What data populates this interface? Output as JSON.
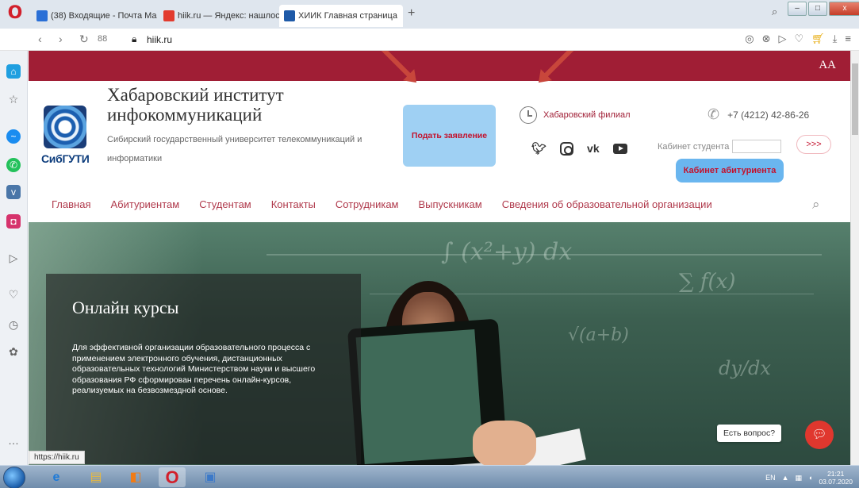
{
  "browser": {
    "tabs": [
      {
        "label": "(38) Входящие - Почта Ма",
        "favicon_color": "#2a6fd6"
      },
      {
        "label": "hiik.ru — Яндекс: нашлось",
        "favicon_color": "#e23b2e"
      },
      {
        "label": "ХИИК Главная страница",
        "favicon_color": "#1e5aa8"
      }
    ],
    "new_tab": "+",
    "address": "hiik.ru",
    "speed_dial_glyph": "88",
    "status_url": "https://hiik.ru",
    "opera_logo": "O",
    "window_controls": {
      "minimize": "–",
      "maximize": "□",
      "close": "x"
    }
  },
  "site": {
    "font_toggle": "AA",
    "logo_text": "СибГУТИ",
    "title": "Хабаровский институт инфокоммуникаций",
    "subtitle": "Сибирский государственный университет телекоммуникаций и информатики",
    "apply_button": "Подать заявление",
    "branch": "Хабаровский филиал",
    "phone": "+7 (4212) 42-86-26",
    "socials": [
      "twitter",
      "instagram",
      "vk",
      "youtube"
    ],
    "student_cabinet_label": "Кабинет студента",
    "go_button": ">>>",
    "applicant_button": "Кабинет абитуриента",
    "nav": [
      "Главная",
      "Абитуриентам",
      "Студентам",
      "Контакты",
      "Сотрудникам",
      "Выпускникам",
      "Сведения об образовательной организации"
    ],
    "hero": {
      "title": "Онлайн курсы",
      "text": "Для эффективной организации образовательного процесса с применением электронного обучения, дистанционных образовательных технологий Министерством науки и высшего образования РФ сформирован перечень онлайн-курсов, реализуемых на безвозмездной основе."
    },
    "chat_label": "Есть вопрос?"
  },
  "taskbar": {
    "lang": "EN",
    "time": "21:21",
    "date": "03.07.2020"
  },
  "colors": {
    "brand": "#a01e35",
    "apply_bg": "#9fd0f3",
    "applicant_bg": "#6ab6ef",
    "chat": "#e0372e"
  }
}
